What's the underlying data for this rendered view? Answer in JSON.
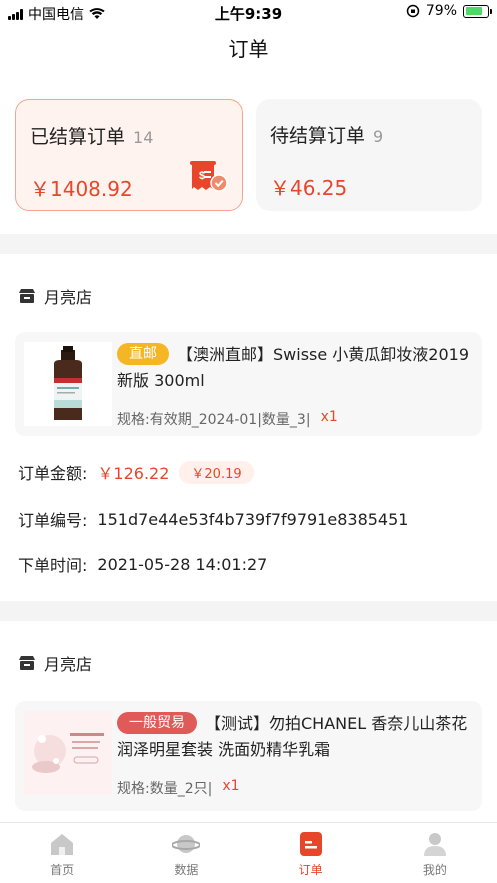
{
  "status_bar": {
    "carrier": "中国电信",
    "time": "上午9:39",
    "battery_percent": "79%",
    "battery_level": 0.79
  },
  "nav": {
    "title": "订单"
  },
  "summary": {
    "settled": {
      "label": "已结算订单",
      "count": "14",
      "amount": "￥1408.92"
    },
    "pending": {
      "label": "待结算订单",
      "count": "9",
      "amount": "￥46.25"
    }
  },
  "orders": [
    {
      "shop": "月亮店",
      "tag": "直邮",
      "title": "【澳洲直邮】Swisse 小黄瓜卸妆液2019新版 300ml",
      "spec": "规格:有效期_2024-01|数量_3|",
      "qty": "x1",
      "amount_label": "订单金额:",
      "amount": "￥126.22",
      "commission": "￥20.19",
      "number_label": "订单编号:",
      "number": "151d7e44e53f4b739f7f9791e8385451",
      "time_label": "下单时间:",
      "time": "2021-05-28 14:01:27"
    },
    {
      "shop": "月亮店",
      "tag": "一般贸易",
      "title": "【测试】勿拍CHANEL 香奈儿山茶花润泽明星套装 洗面奶精华乳霜",
      "spec": "规格:数量_2只|",
      "qty": "x1"
    }
  ],
  "tabbar": [
    {
      "label": "首页",
      "icon": "home-icon"
    },
    {
      "label": "数据",
      "icon": "planet-icon"
    },
    {
      "label": "订单",
      "icon": "order-icon",
      "active": true
    },
    {
      "label": "我的",
      "icon": "profile-icon"
    }
  ],
  "colors": {
    "accent": "#e8462b",
    "tag_direct": "#f5b623",
    "tag_general": "#e05a5a"
  }
}
